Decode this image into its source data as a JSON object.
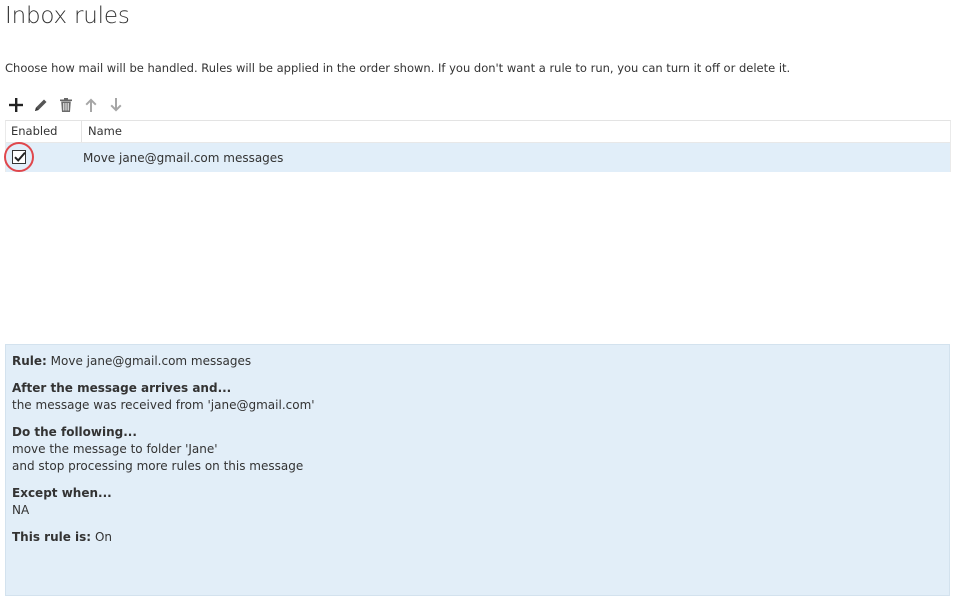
{
  "page": {
    "title": "Inbox rules",
    "description": "Choose how mail will be handled. Rules will be applied in the order shown. If you don't want a rule to run, you can turn it off or delete it."
  },
  "toolbar": {
    "icons": [
      "plus-icon",
      "pencil-icon",
      "trash-icon",
      "arrow-up-icon",
      "arrow-down-icon"
    ]
  },
  "table": {
    "columns": [
      "Enabled",
      "Name"
    ],
    "rows": [
      {
        "enabled": true,
        "name": "Move jane@gmail.com messages"
      }
    ]
  },
  "details": {
    "rule_label": "Rule:",
    "rule_value": "Move jane@gmail.com messages",
    "after_label": "After the message arrives and...",
    "after_value": "the message was received from 'jane@gmail.com'",
    "do_label": "Do the following...",
    "do_values": [
      "move the message to folder 'Jane'",
      "and stop processing more rules on this message"
    ],
    "except_label": "Except when...",
    "except_value": "NA",
    "status_label": "This rule is:",
    "status_value": "On"
  },
  "colors": {
    "selected_row": "#e1eef9",
    "details_bg": "#e2eef8",
    "highlight_ring": "#e0474c",
    "icon_dark": "#333333",
    "icon_disabled": "#a6a6a6"
  }
}
